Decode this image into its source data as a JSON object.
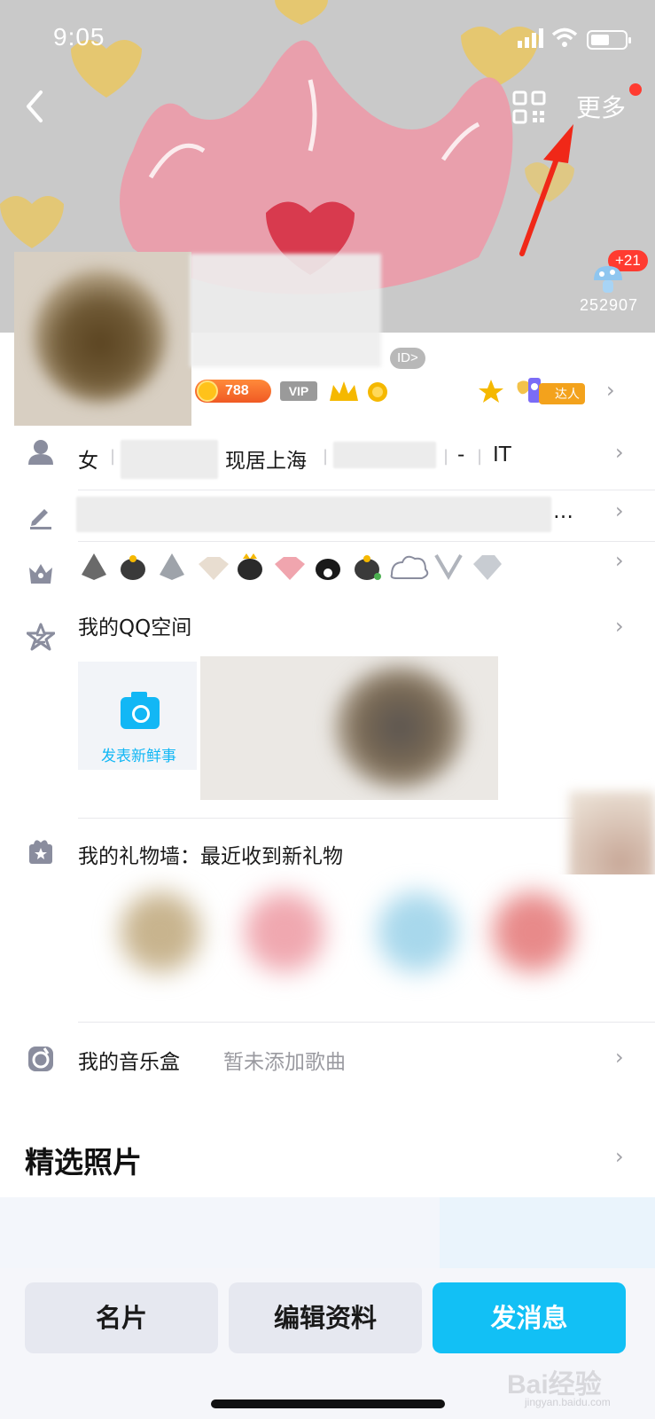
{
  "status_bar": {
    "time": "9:05"
  },
  "header": {
    "more_label": "更多",
    "visitor_badge": "+21",
    "visitor_count": "252907"
  },
  "profile": {
    "id_label": "ID>",
    "coin_value": "788",
    "vip_label": "VIP",
    "talent_label": "达人"
  },
  "info_row": {
    "gender": "女",
    "residence": "现居上海",
    "dash": "-",
    "industry": "IT"
  },
  "signature_row": {
    "ellipsis": "…"
  },
  "qzone": {
    "title": "我的QQ空间",
    "post_label": "发表新鲜事"
  },
  "gift_wall": {
    "title": "我的礼物墙：最近收到新礼物"
  },
  "music_box": {
    "title": "我的音乐盒",
    "subtitle": "暂未添加歌曲"
  },
  "featured": {
    "title": "精选照片"
  },
  "bottom_bar": {
    "card_label": "名片",
    "edit_label": "编辑资料",
    "message_label": "发消息"
  },
  "watermark": {
    "brand": "Bai经验",
    "url": "jingyan.baidu.com"
  },
  "colors": {
    "accent_blue": "#12C0F5",
    "notification_red": "#FF3B30",
    "coin_orange": "#F05A24"
  }
}
